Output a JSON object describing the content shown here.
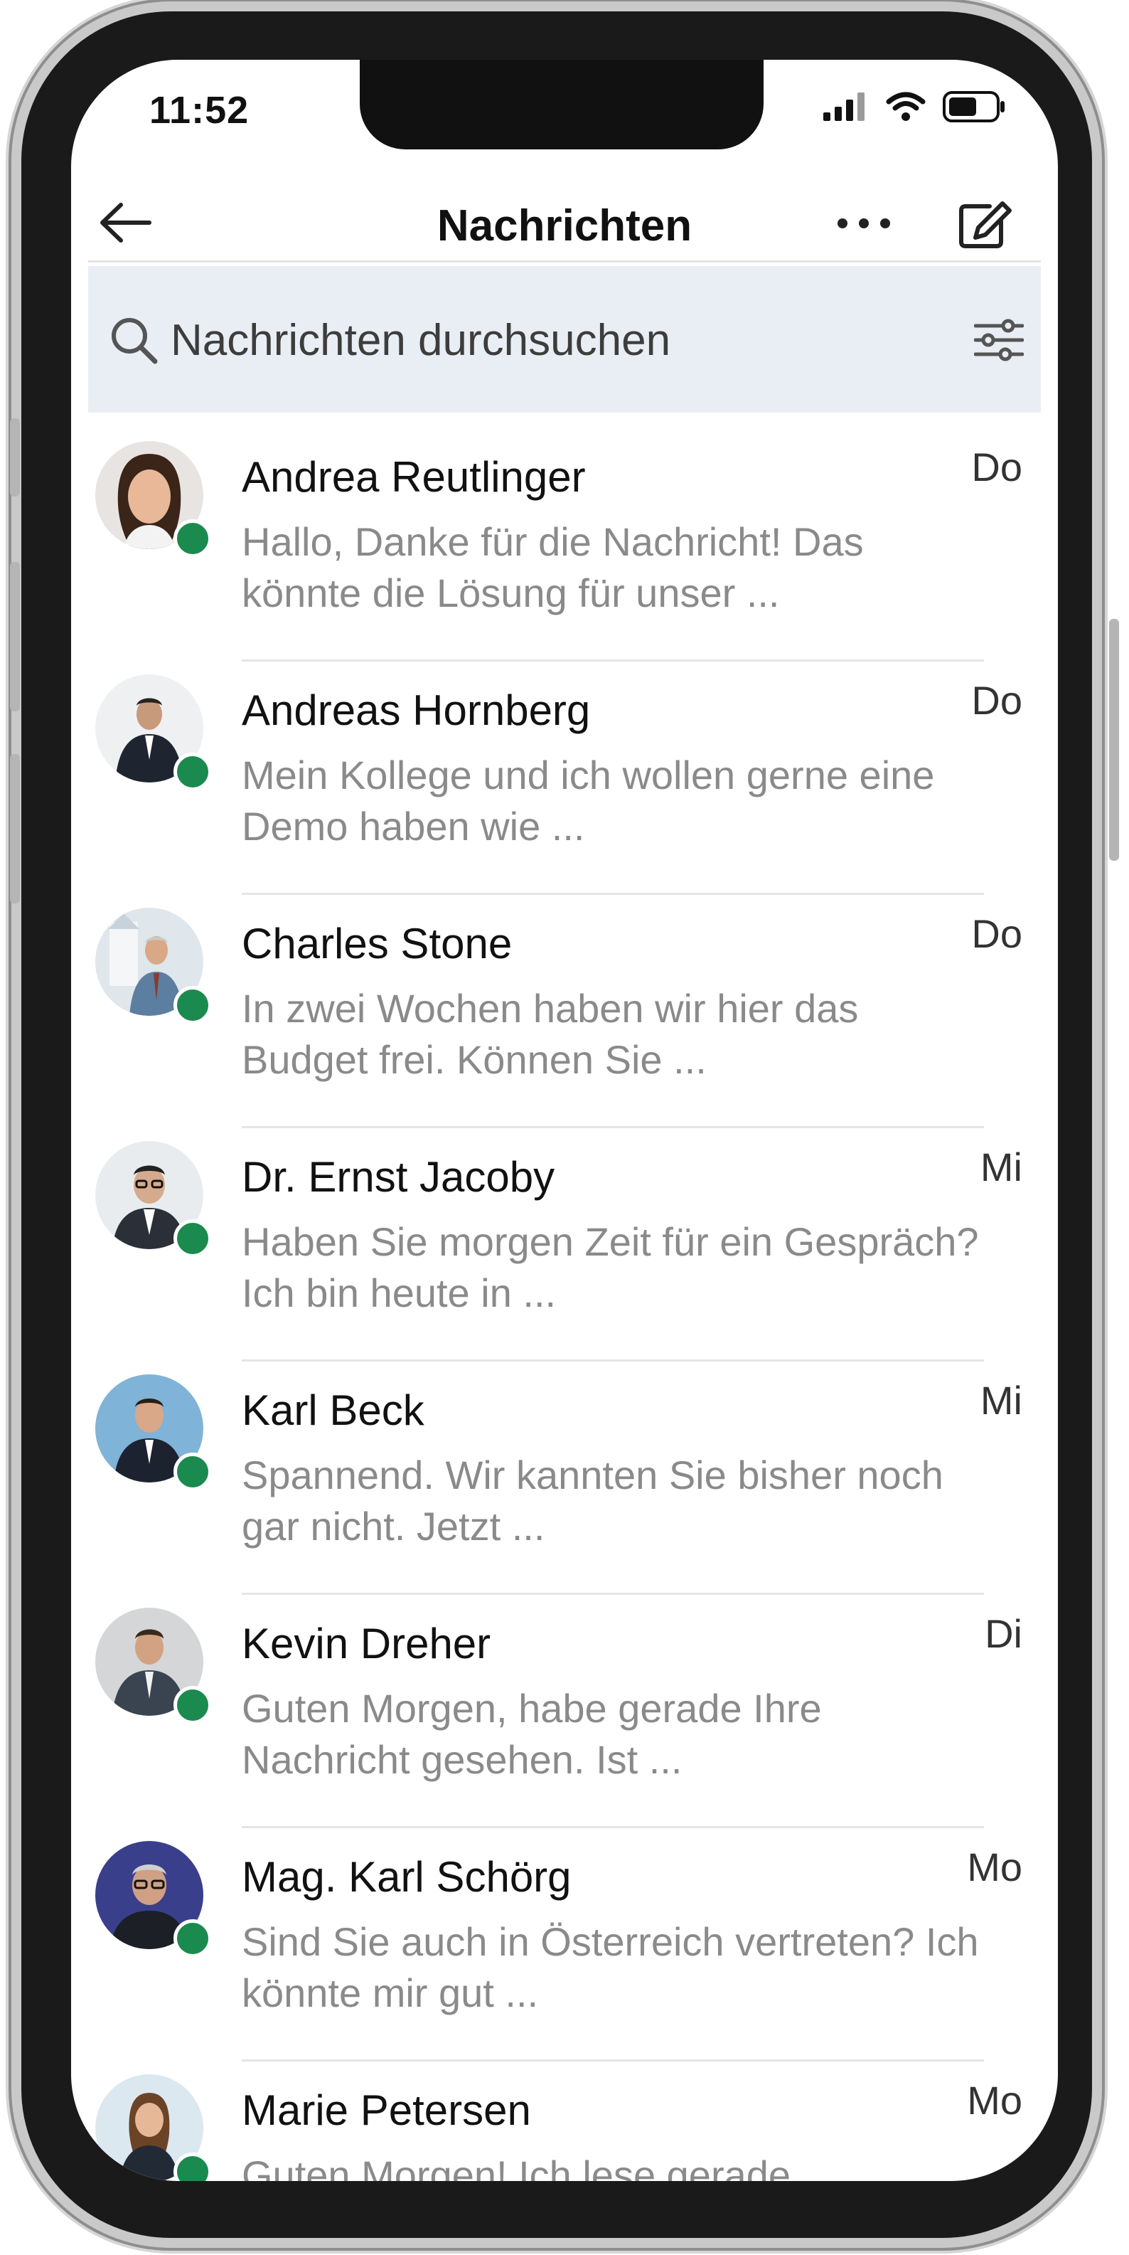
{
  "status_bar": {
    "time": "11:52",
    "icons": [
      "cellular-signal-icon",
      "wifi-icon",
      "battery-icon"
    ]
  },
  "header": {
    "title": "Nachrichten",
    "icons": [
      "back-arrow-icon",
      "more-dots-icon",
      "compose-icon"
    ]
  },
  "search": {
    "placeholder": "Nachrichten durchsuchen",
    "icons": [
      "search-icon",
      "filter-sliders-icon"
    ]
  },
  "colors": {
    "online_indicator": "#1a8a4e",
    "search_background": "#e9eef4",
    "preview_text": "#8a8a8a"
  },
  "conversations": [
    {
      "name": "Andrea Reutlinger",
      "day": "Do",
      "preview": "Hallo, Danke für die Nachricht! Das könnte die Lösung für unser ...",
      "online": true
    },
    {
      "name": "Andreas Hornberg",
      "day": "Do",
      "preview": "Mein Kollege und ich wollen gerne eine Demo haben wie ...",
      "online": true
    },
    {
      "name": "Charles Stone",
      "day": "Do",
      "preview": "In zwei Wochen haben wir hier das Budget frei. Können Sie ...",
      "online": true
    },
    {
      "name": "Dr. Ernst Jacoby",
      "day": "Mi",
      "preview": "Haben Sie morgen Zeit für ein Gespräch? Ich bin heute in ...",
      "online": true
    },
    {
      "name": "Karl Beck",
      "day": "Mi",
      "preview": "Spannend. Wir kannten Sie bisher noch gar nicht. Jetzt ...",
      "online": true
    },
    {
      "name": "Kevin Dreher",
      "day": "Di",
      "preview": "Guten Morgen, habe gerade Ihre Nachricht gesehen. Ist ...",
      "online": true
    },
    {
      "name": "Mag. Karl Schörg",
      "day": "Mo",
      "preview": "Sind Sie auch in Österreich vertreten? Ich könnte mir gut ...",
      "online": true
    },
    {
      "name": "Marie Petersen",
      "day": "Mo",
      "preview": "Guten Morgen! Ich lese gerade",
      "online": true
    }
  ]
}
